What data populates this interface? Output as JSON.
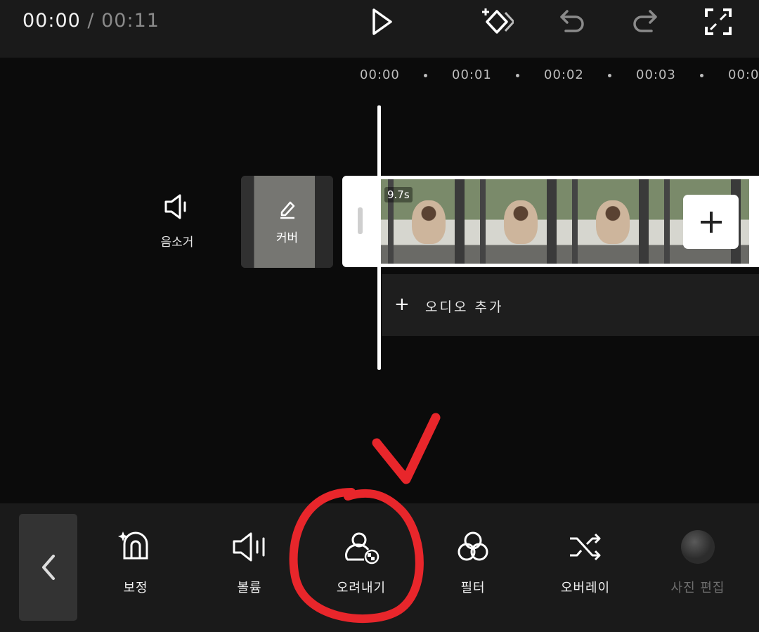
{
  "header": {
    "current_time": "00:00",
    "separator": "/",
    "duration": "00:11",
    "icons": [
      "play-icon",
      "keyframe-add-icon",
      "undo-icon",
      "redo-icon",
      "fullscreen-icon"
    ]
  },
  "timeline": {
    "ruler": [
      "00:00",
      "00:01",
      "00:02",
      "00:03",
      "00:0"
    ],
    "mute_label": "음소거",
    "cover_label": "커버",
    "clip_duration": "9.7s",
    "add_audio_label": "오디오 추가"
  },
  "toolbar": {
    "items": [
      {
        "label": "보정",
        "icon": "adjust-icon"
      },
      {
        "label": "볼륨",
        "icon": "volume-icon"
      },
      {
        "label": "오려내기",
        "icon": "cutout-icon"
      },
      {
        "label": "필터",
        "icon": "filter-icon"
      },
      {
        "label": "오버레이",
        "icon": "overlay-icon"
      },
      {
        "label": "사진 편집",
        "icon": "photo-edit-icon"
      }
    ]
  },
  "colors": {
    "annotation": "#e8262b",
    "background": "#0b0b0b",
    "bar": "#1a1a1a"
  }
}
